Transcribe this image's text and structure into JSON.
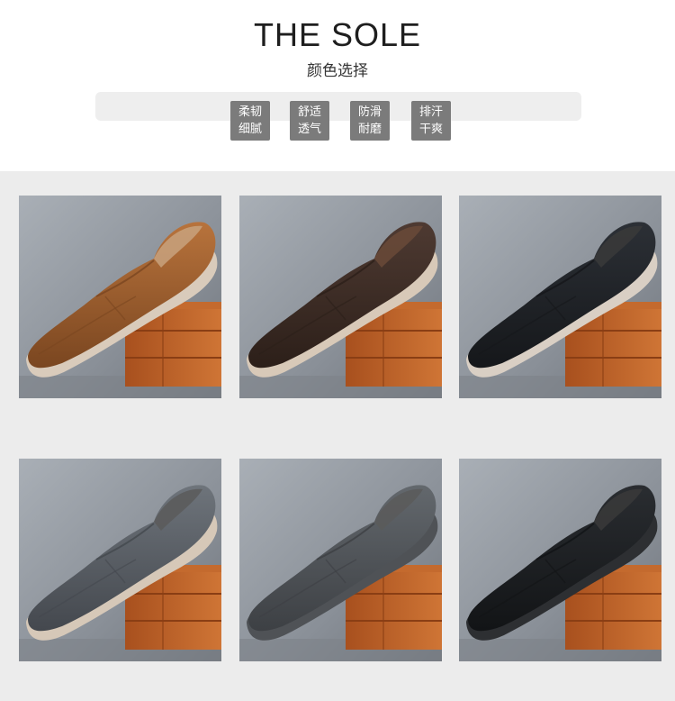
{
  "header": {
    "title": "THE SOLE",
    "subtitle": "颜色选择"
  },
  "features": [
    {
      "line1": "柔韧",
      "line2": "细腻"
    },
    {
      "line1": "舒适",
      "line2": "透气"
    },
    {
      "line1": "防滑",
      "line2": "耐磨"
    },
    {
      "line1": "排汗",
      "line2": "干爽"
    }
  ],
  "products": [
    {
      "name": "brown-tan",
      "upper": "#b8733c",
      "dark": "#7a4620",
      "sole": "#d9cbbb",
      "fur": "#c8a27e"
    },
    {
      "name": "dark-brown",
      "upper": "#4e3a32",
      "dark": "#2c1f19",
      "sole": "#d8c9b8",
      "fur": "#6a4a38"
    },
    {
      "name": "black",
      "upper": "#2c3036",
      "dark": "#15171a",
      "sole": "#d9cfc4",
      "fur": "#3a3a3a"
    },
    {
      "name": "grey",
      "upper": "#6e747b",
      "dark": "#44484e",
      "sole": "#d6c8b8",
      "fur": "#5a5a5a"
    },
    {
      "name": "grey-dark-sole",
      "upper": "#63686d",
      "dark": "#3d4044",
      "sole": "#4f5256",
      "fur": "#5a5a5a"
    },
    {
      "name": "black-dark-sole",
      "upper": "#2a2d31",
      "dark": "#121416",
      "sole": "#2d2f32",
      "fur": "#3a3a3a"
    }
  ]
}
